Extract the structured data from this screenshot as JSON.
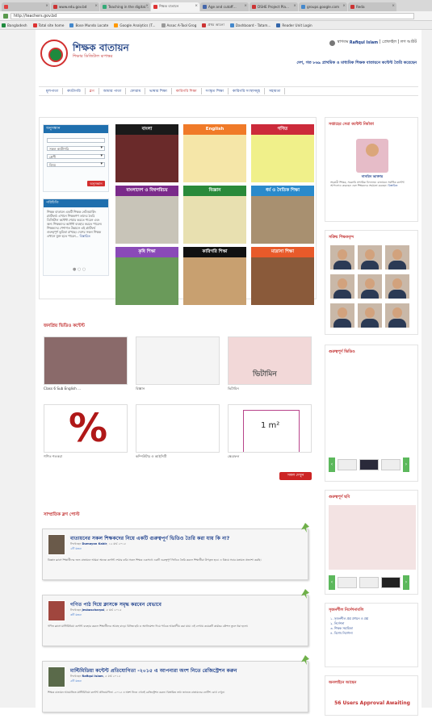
{
  "browser": {
    "tabs": [
      {
        "label": "",
        "active": false,
        "color": "#e04040"
      },
      {
        "label": "www.edu.gov.bd",
        "active": false,
        "color": "#c33"
      },
      {
        "label": "Teaching in the digital...",
        "active": false,
        "color": "#3a7"
      },
      {
        "label": "শিক্ষক বাতায়ন",
        "active": true,
        "color": "#d33"
      },
      {
        "label": "Age and cutoff...",
        "active": false,
        "color": "#46a"
      },
      {
        "label": "DSHE Project Pla...",
        "active": false,
        "color": "#c33"
      },
      {
        "label": "groups.google.com",
        "active": false,
        "color": "#48c"
      },
      {
        "label": "Reda",
        "active": false,
        "color": "#c33"
      }
    ],
    "url": "http://teachers.gov.bd",
    "bookmarks": [
      {
        "label": "Bangladesh",
        "color": "#1e8a3e"
      },
      {
        "label": "Total site home",
        "color": "#d33"
      },
      {
        "label": "Bose Mundo Locate",
        "color": "#48c"
      },
      {
        "label": "Google Analytics (T...",
        "color": "#f90"
      },
      {
        "label": "Assoc A-Tool Grog",
        "color": "#999"
      },
      {
        "label": "প্রথম আলো",
        "color": "#c33"
      },
      {
        "label": "Dashboard - Tatam...",
        "color": "#48c"
      },
      {
        "label": "Reader Unit Login",
        "color": "#36a"
      }
    ]
  },
  "header": {
    "title": "শিক্ষক বাতায়ন",
    "subtitle": "শিক্ষার ডিজিটাল রূপান্তর",
    "user_prefix": "স্বাগতম",
    "user_name": "Rafiqul Islam",
    "user_links": "[ প্রোফাইল ] লগ আউট",
    "tagline": "দেশ, গত ৮৬৯ প্রাথমিক ও মাধ্যমিক শিক্ষক বাতায়নে কন্টেন্ট তৈরি করেছেন"
  },
  "nav": [
    {
      "label": "মূলপাতা",
      "hot": false
    },
    {
      "label": "ক্যাটাগরি",
      "hot": false
    },
    {
      "label": "ব্লগ",
      "hot": true
    },
    {
      "label": "আমার পাতা",
      "hot": false
    },
    {
      "label": "ফোরাম",
      "hot": false
    },
    {
      "label": "ভাষার শিক্ষা",
      "hot": false
    },
    {
      "label": "কারিগরি শিক্ষা",
      "hot": true
    },
    {
      "label": "সংস্কৃত শিক্ষা",
      "hot": false
    },
    {
      "label": "কারিগরি সংস্থাসমূহ",
      "hot": false
    },
    {
      "label": "সহায়তা",
      "hot": false
    }
  ],
  "search_panel": {
    "heading": "অনুসন্ধান",
    "search_placeholder": "",
    "select_1": "সকল ক্যাটাগরি",
    "select_2": "শ্রেণী",
    "select_3": "বিষয়",
    "button": "অনুসন্ধান"
  },
  "about_panel": {
    "heading": "পরিচিতি",
    "text": "শিক্ষক বাতায়ন একটি শিক্ষক নেটওয়ার্কিং প্ল্যাটফর্ম। এখানে শিক্ষকগণ তাদের তৈরি ডিজিটাল কন্টেন্ট শেয়ার করতে পারেন এবং অন্য শিক্ষকদের কন্টেন্ট ব্যবহার করতে পারেন। শিক্ষকদের পেশাগত উন্নয়নে এই প্ল্যাটফর্ম গুরুত্বপূর্ণ ভূমিকা রাখছে। দেশের সকল শিক্ষক এখানে যুক্ত হতে পারেন...",
    "more": "বিস্তারিত"
  },
  "tiles": [
    {
      "label": "বাংলা",
      "color": "#1a1a1a",
      "img": "#6a2a2a"
    },
    {
      "label": "English",
      "color": "#f07a28",
      "img": "#f5e6a8"
    },
    {
      "label": "গণিত",
      "color": "#cc2a3a",
      "img": "#f0f08a"
    },
    {
      "label": "বাংলাদেশ ও বিশ্বপরিচয়",
      "color": "#7a2a8a",
      "img": "#c8c4b8"
    },
    {
      "label": "বিজ্ঞান",
      "color": "#2a8a3a",
      "img": "#e8e0b0"
    },
    {
      "label": "ধর্ম ও নৈতিক শিক্ষা",
      "color": "#2a8acb",
      "img": "#a89070"
    },
    {
      "label": "কৃষি শিক্ষা",
      "color": "#8a4ab8",
      "img": "#6a9a5a"
    },
    {
      "label": "কারিগরি শিক্ষা",
      "color": "#111111",
      "img": "#c8a070"
    },
    {
      "label": "মাদ্রাসা শিক্ষা",
      "color": "#e85a2a",
      "img": "#8a5a3a"
    }
  ],
  "videos": {
    "heading": "জনপ্রিয় ভিডিও কন্টেন্ট",
    "items": [
      {
        "caption": "Class 6 Sub English ...",
        "bg": "#8a6a6a"
      },
      {
        "caption": "বিজ্ঞান",
        "bg": "#f4f4f4"
      },
      {
        "caption": "ভিটামিন",
        "bg": "#f2d8d8"
      },
      {
        "caption": "গণিত শতকরা",
        "bg": "#ffffff"
      },
      {
        "caption": "কম্পিউটার ও আইসিটি",
        "bg": "#ffffff"
      },
      {
        "caption": "ক্ষেত্রফল",
        "bg": "#ffffff"
      }
    ],
    "tile_text_vitamin": "ভিটামিন",
    "tile_text_area": "1 m²",
    "more_button": "সকল দেখুন"
  },
  "posts": {
    "heading": "সাম্প্রতিক ব্লগ পোস্ট",
    "items": [
      {
        "title": "বাতায়নের সকল শিক্ষকদের নিয়ে একটি গুরুত্বপূর্ণ ভিডিও তৈরি করা যায় কি না?",
        "meta_prefix": "লিখেছেন",
        "author": "Dumayan Kabir",
        "date": "১২ মার্চ ২০১৫",
        "likes": "২টি মন্তব্য",
        "body": "বিজ্ঞান ক্লাসে শিক্ষার্থীদের জন্য বাতায়নে আমরা অনেক কন্টেন্ট শেয়ার করি। সকল শিক্ষক একসাথে একটি গুরুত্বপূর্ণ ভিডিও তৈরি করলে শিক্ষার্থীরা উপকৃত হবে। এ বিষয়ে সবার মতামত প্রত্যাশা করছি।"
      },
      {
        "title": "গণিত পাঠ দিয়ে ক্লাসকে সমৃদ্ধ করবেন যেভাবে",
        "meta_prefix": "লিখেছেন",
        "author": "Jesbascharpsi",
        "date": "৮ মার্চ ২০১৫",
        "likes": "৩টি মন্তব্য",
        "body": "গণিত ক্লাসে মাল্টিমিডিয়া কন্টেন্ট ব্যবহার করলে শিক্ষার্থীদের আগ্রহ বাড়ে। বিভিন্ন ছবি ও অ্যানিমেশন দিয়ে পাঠকে আকর্ষণীয় করা যায়। এই লেখায় কয়েকটি কার্যকর কৌশল তুলে ধরা হলো।"
      },
      {
        "title": "মাল্টিমিডিয়া কন্টেন্ট প্রতিযোগিতা -২০১৫ এ আপনারা অংশ নিতে রেজিস্ট্রেশন করুন",
        "meta_prefix": "লিখেছেন",
        "author": "Rafiqul Islam",
        "date": "৫ মার্চ ২০১৫",
        "likes": "৫টি মন্তব্য",
        "body": "শিক্ষক বাতায়ন আয়োজিত মাল্টিমিডিয়া কন্টেন্ট প্রতিযোগিতা -২০১৫ এ অংশ নিতে এখনই রেজিস্ট্রেশন করুন। বিস্তারিত তথ্য জানতে বাতায়নের নোটিশ বোর্ড দেখুন।"
      }
    ]
  },
  "sidebar": {
    "best_teacher_heading": "সপ্তাহের সেরা কন্টেন্ট নির্মাতা",
    "best_teacher_name": "নাসরিন আক্তার",
    "best_teacher_desc": "সহকারী শিক্ষক, সরকারি প্রাথমিক বিদ্যালয়। বাতায়নে সর্বাধিক কন্টেন্ট আপলোড করেছেন এবং শিক্ষকদের সহায়তা করছেন।",
    "best_teacher_more": "বিস্তারিত",
    "active_heading": "সক্রিয় শিক্ষকবৃন্দ",
    "important_video_heading": "গুরুত্বপূর্ণ ভিডিও",
    "important_image_heading": "গুরুত্বপূর্ণ ছবি",
    "links_heading": "সৃজনশীল নির্দেশনাবলি",
    "links": [
      "১. সৃজনশীল প্রশ্ন প্রণয়ন ও প্রশ্ন",
      "২. নির্দেশনা",
      "৩. শিক্ষক সহায়িকা",
      "৪. বিশেষ নির্দেশনা"
    ],
    "visitors_heading": "অনলাইনে আছেন",
    "visitors_text": "56 Users Approval Awaiting"
  }
}
